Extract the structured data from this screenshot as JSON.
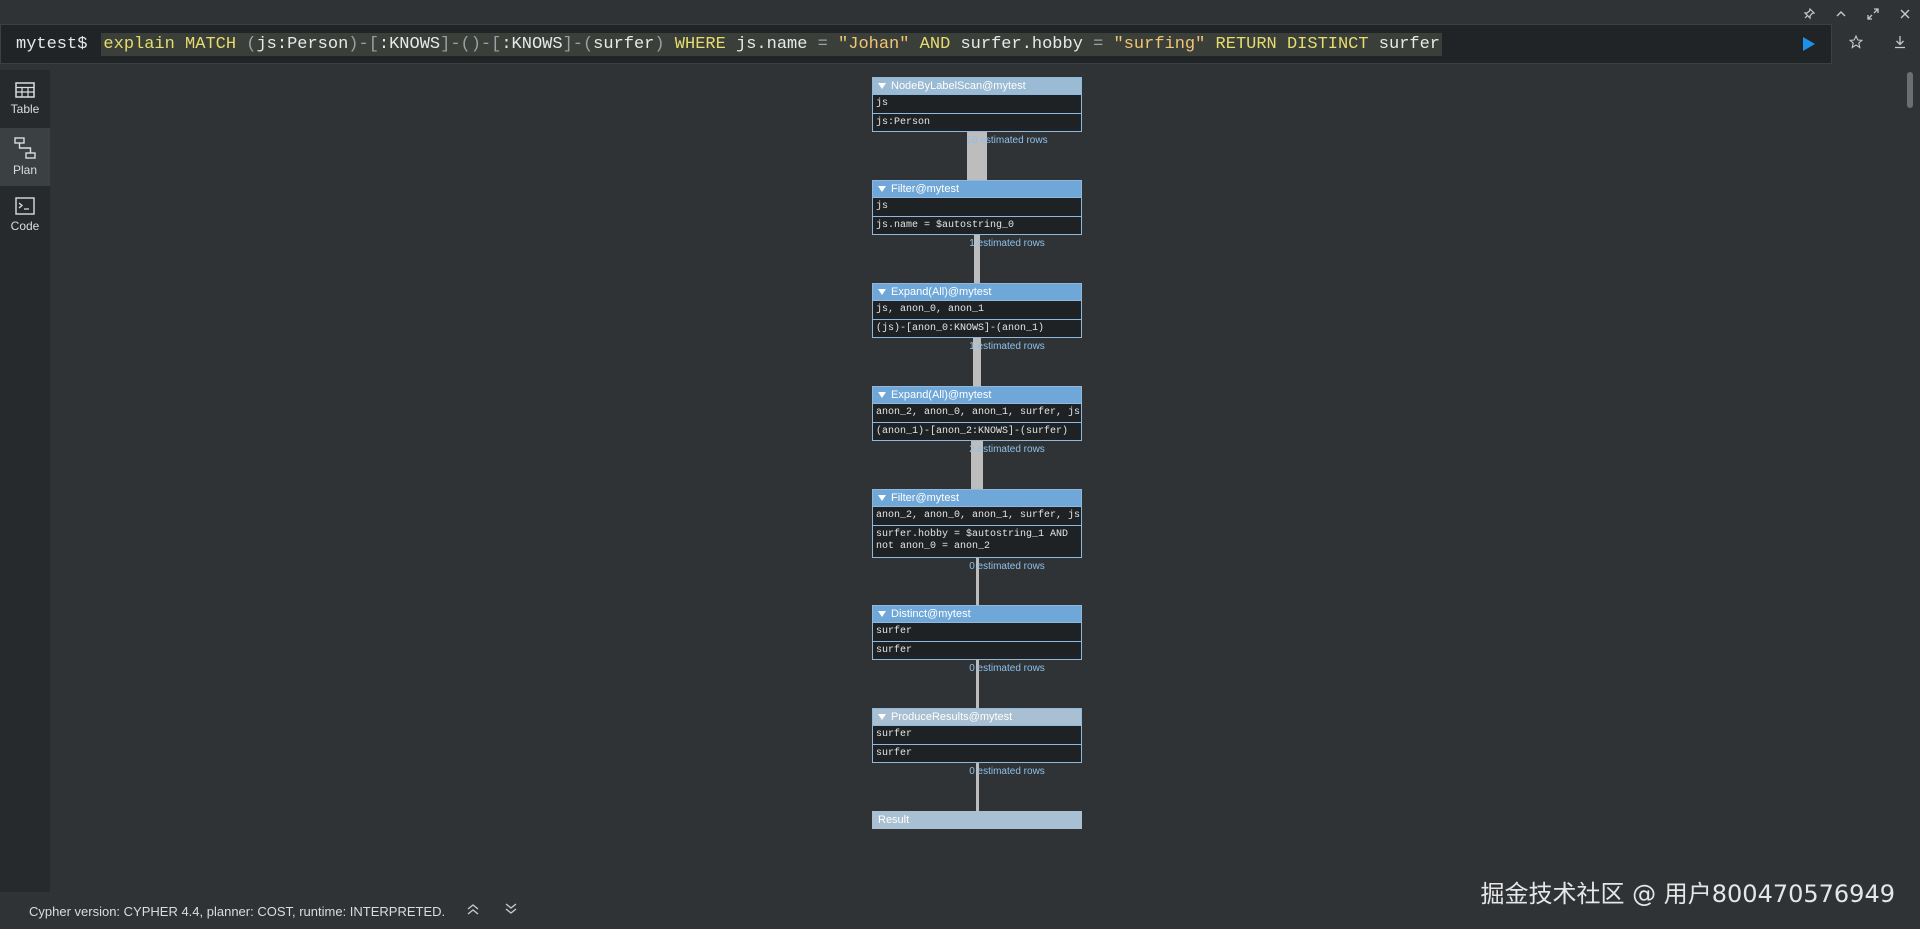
{
  "editor": {
    "prompt": "mytest$",
    "query_tokens": [
      {
        "t": "explain",
        "c": "kw"
      },
      {
        "t": " ",
        "c": "id"
      },
      {
        "t": "MATCH",
        "c": "kw"
      },
      {
        "t": " ",
        "c": "id"
      },
      {
        "t": "(",
        "c": "pun"
      },
      {
        "t": "js:Person",
        "c": "id"
      },
      {
        "t": ")-[",
        "c": "pun"
      },
      {
        "t": ":KNOWS",
        "c": "id"
      },
      {
        "t": "]-()-[",
        "c": "pun"
      },
      {
        "t": ":KNOWS",
        "c": "id"
      },
      {
        "t": "]-(",
        "c": "pun"
      },
      {
        "t": "surfer",
        "c": "id"
      },
      {
        "t": ") ",
        "c": "pun"
      },
      {
        "t": "WHERE",
        "c": "kw"
      },
      {
        "t": " js.name ",
        "c": "id"
      },
      {
        "t": "= ",
        "c": "pun"
      },
      {
        "t": "\"Johan\"",
        "c": "str"
      },
      {
        "t": " ",
        "c": "id"
      },
      {
        "t": "AND",
        "c": "kw"
      },
      {
        "t": " surfer.hobby ",
        "c": "id"
      },
      {
        "t": "= ",
        "c": "pun"
      },
      {
        "t": "\"surfing\"",
        "c": "str"
      },
      {
        "t": " ",
        "c": "id"
      },
      {
        "t": "RETURN",
        "c": "kw"
      },
      {
        "t": " ",
        "c": "id"
      },
      {
        "t": "DISTINCT",
        "c": "kw"
      },
      {
        "t": " surfer",
        "c": "id"
      }
    ]
  },
  "sidebar": {
    "items": [
      {
        "label": "Table",
        "icon": "table-icon"
      },
      {
        "label": "Plan",
        "icon": "plan-icon"
      },
      {
        "label": "Code",
        "icon": "code-icon"
      }
    ]
  },
  "plan": {
    "nodes": [
      {
        "name": "NodeByLabelScan@mytest",
        "rows": [
          "js",
          "js:Person"
        ],
        "color": "#9bbad4"
      },
      {
        "name": "Filter@mytest",
        "rows": [
          "js",
          "js.name = $autostring_0"
        ],
        "color": "#6fa8d8"
      },
      {
        "name": "Expand(All)@mytest",
        "rows": [
          "js, anon_0, anon_1",
          "(js)-[anon_0:KNOWS]-(anon_1)"
        ],
        "color": "#6fa8d8"
      },
      {
        "name": "Expand(All)@mytest",
        "rows": [
          "anon_2, anon_0, anon_1, surfer, js",
          "(anon_1)-[anon_2:KNOWS]-(surfer)"
        ],
        "color": "#6fa8d8"
      },
      {
        "name": "Filter@mytest",
        "rows": [
          "anon_2, anon_0, anon_1, surfer, js",
          "surfer.hobby = $autostring_1 AND\nnot anon_0 = anon_2"
        ],
        "color": "#6fa8d8"
      },
      {
        "name": "Distinct@mytest",
        "rows": [
          "surfer",
          "surfer"
        ],
        "color": "#6fa8d8"
      },
      {
        "name": "ProduceResults@mytest",
        "rows": [
          "surfer",
          "surfer"
        ],
        "color": "#a9bfd2"
      },
      {
        "name": "Result",
        "rows": [],
        "color": "#a9bfd2"
      }
    ],
    "estimates": [
      "10 estimated rows",
      "1 estimated rows",
      "1 estimated rows",
      "2 estimated rows",
      "0 estimated rows",
      "0 estimated rows",
      "0 estimated rows"
    ]
  },
  "footer": {
    "status": "Cypher version: CYPHER 4.4, planner: COST, runtime: INTERPRETED."
  },
  "watermark": "掘金技术社区 @ 用户800470576949"
}
